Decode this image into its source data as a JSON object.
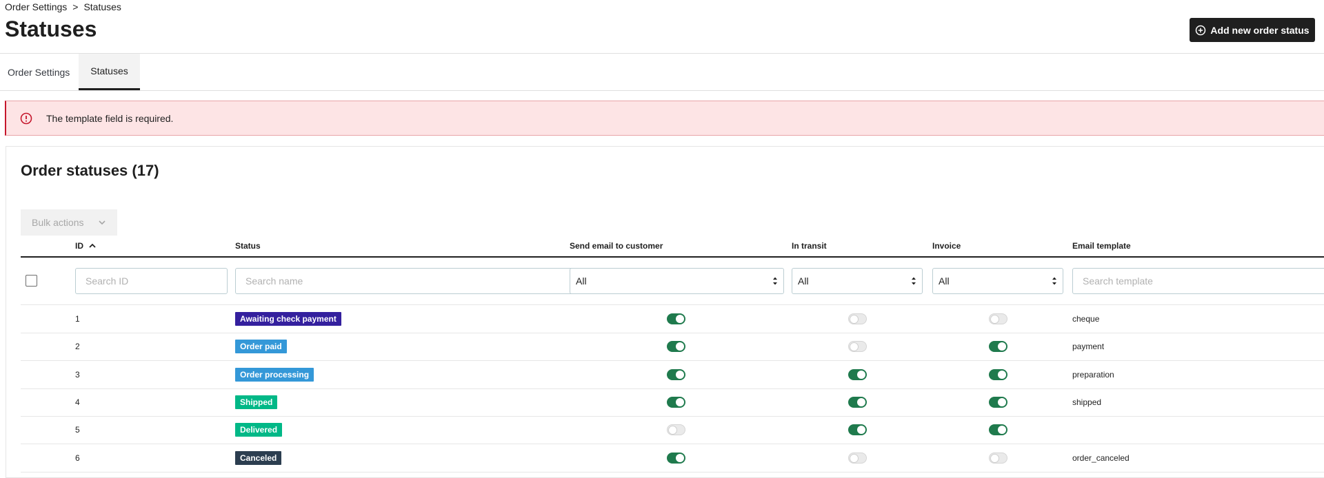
{
  "breadcrumb": {
    "parent": "Order Settings",
    "separator": ">",
    "current": "Statuses"
  },
  "page_title": "Statuses",
  "add_button_label": "Add new order status",
  "tabs": [
    {
      "label": "Order Settings",
      "active": false
    },
    {
      "label": "Statuses",
      "active": true
    }
  ],
  "alert": {
    "message": "The template field is required.",
    "icon": "error-circle-icon"
  },
  "card_title": "Order statuses (17)",
  "bulk_actions_label": "Bulk actions",
  "columns": {
    "id": "ID",
    "status": "Status",
    "send_email": "Send email to customer",
    "in_transit": "In transit",
    "invoice": "Invoice",
    "email_template": "Email template"
  },
  "filters": {
    "id_placeholder": "Search ID",
    "name_placeholder": "Search name",
    "send_email_value": "All",
    "in_transit_value": "All",
    "invoice_value": "All",
    "template_placeholder": "Search template"
  },
  "rows": [
    {
      "id": "1",
      "status": "Awaiting check payment",
      "color": "#34209e",
      "send_email": true,
      "in_transit": false,
      "invoice": false,
      "template": "cheque"
    },
    {
      "id": "2",
      "status": "Order paid",
      "color": "#3498d8",
      "send_email": true,
      "in_transit": false,
      "invoice": true,
      "template": "payment"
    },
    {
      "id": "3",
      "status": "Order processing",
      "color": "#3498d8",
      "send_email": true,
      "in_transit": true,
      "invoice": true,
      "template": "preparation"
    },
    {
      "id": "4",
      "status": "Shipped",
      "color": "#01b887",
      "send_email": true,
      "in_transit": true,
      "invoice": true,
      "template": "shipped"
    },
    {
      "id": "5",
      "status": "Delivered",
      "color": "#01b887",
      "send_email": false,
      "in_transit": true,
      "invoice": true,
      "template": ""
    },
    {
      "id": "6",
      "status": "Canceled",
      "color": "#2c3e50",
      "send_email": true,
      "in_transit": false,
      "invoice": false,
      "template": "order_canceled"
    }
  ],
  "colors": {
    "toggle_on": "#1f7a4d",
    "alert_bg": "#fde4e5",
    "alert_accent": "#c5162c",
    "primary_button": "#1f1f1f"
  }
}
